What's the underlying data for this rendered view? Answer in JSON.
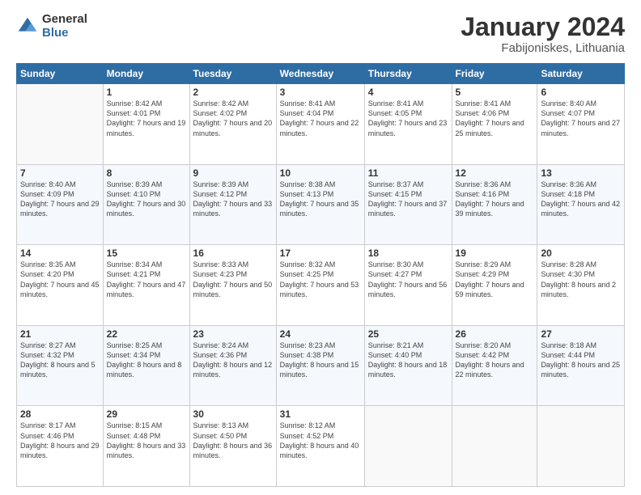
{
  "logo": {
    "general": "General",
    "blue": "Blue"
  },
  "title": "January 2024",
  "subtitle": "Fabijoniskes, Lithuania",
  "days": [
    "Sunday",
    "Monday",
    "Tuesday",
    "Wednesday",
    "Thursday",
    "Friday",
    "Saturday"
  ],
  "weeks": [
    [
      {
        "date": "",
        "sunrise": "",
        "sunset": "",
        "daylight": ""
      },
      {
        "date": "1",
        "sunrise": "Sunrise: 8:42 AM",
        "sunset": "Sunset: 4:01 PM",
        "daylight": "Daylight: 7 hours and 19 minutes."
      },
      {
        "date": "2",
        "sunrise": "Sunrise: 8:42 AM",
        "sunset": "Sunset: 4:02 PM",
        "daylight": "Daylight: 7 hours and 20 minutes."
      },
      {
        "date": "3",
        "sunrise": "Sunrise: 8:41 AM",
        "sunset": "Sunset: 4:04 PM",
        "daylight": "Daylight: 7 hours and 22 minutes."
      },
      {
        "date": "4",
        "sunrise": "Sunrise: 8:41 AM",
        "sunset": "Sunset: 4:05 PM",
        "daylight": "Daylight: 7 hours and 23 minutes."
      },
      {
        "date": "5",
        "sunrise": "Sunrise: 8:41 AM",
        "sunset": "Sunset: 4:06 PM",
        "daylight": "Daylight: 7 hours and 25 minutes."
      },
      {
        "date": "6",
        "sunrise": "Sunrise: 8:40 AM",
        "sunset": "Sunset: 4:07 PM",
        "daylight": "Daylight: 7 hours and 27 minutes."
      }
    ],
    [
      {
        "date": "7",
        "sunrise": "Sunrise: 8:40 AM",
        "sunset": "Sunset: 4:09 PM",
        "daylight": "Daylight: 7 hours and 29 minutes."
      },
      {
        "date": "8",
        "sunrise": "Sunrise: 8:39 AM",
        "sunset": "Sunset: 4:10 PM",
        "daylight": "Daylight: 7 hours and 30 minutes."
      },
      {
        "date": "9",
        "sunrise": "Sunrise: 8:39 AM",
        "sunset": "Sunset: 4:12 PM",
        "daylight": "Daylight: 7 hours and 33 minutes."
      },
      {
        "date": "10",
        "sunrise": "Sunrise: 8:38 AM",
        "sunset": "Sunset: 4:13 PM",
        "daylight": "Daylight: 7 hours and 35 minutes."
      },
      {
        "date": "11",
        "sunrise": "Sunrise: 8:37 AM",
        "sunset": "Sunset: 4:15 PM",
        "daylight": "Daylight: 7 hours and 37 minutes."
      },
      {
        "date": "12",
        "sunrise": "Sunrise: 8:36 AM",
        "sunset": "Sunset: 4:16 PM",
        "daylight": "Daylight: 7 hours and 39 minutes."
      },
      {
        "date": "13",
        "sunrise": "Sunrise: 8:36 AM",
        "sunset": "Sunset: 4:18 PM",
        "daylight": "Daylight: 7 hours and 42 minutes."
      }
    ],
    [
      {
        "date": "14",
        "sunrise": "Sunrise: 8:35 AM",
        "sunset": "Sunset: 4:20 PM",
        "daylight": "Daylight: 7 hours and 45 minutes."
      },
      {
        "date": "15",
        "sunrise": "Sunrise: 8:34 AM",
        "sunset": "Sunset: 4:21 PM",
        "daylight": "Daylight: 7 hours and 47 minutes."
      },
      {
        "date": "16",
        "sunrise": "Sunrise: 8:33 AM",
        "sunset": "Sunset: 4:23 PM",
        "daylight": "Daylight: 7 hours and 50 minutes."
      },
      {
        "date": "17",
        "sunrise": "Sunrise: 8:32 AM",
        "sunset": "Sunset: 4:25 PM",
        "daylight": "Daylight: 7 hours and 53 minutes."
      },
      {
        "date": "18",
        "sunrise": "Sunrise: 8:30 AM",
        "sunset": "Sunset: 4:27 PM",
        "daylight": "Daylight: 7 hours and 56 minutes."
      },
      {
        "date": "19",
        "sunrise": "Sunrise: 8:29 AM",
        "sunset": "Sunset: 4:29 PM",
        "daylight": "Daylight: 7 hours and 59 minutes."
      },
      {
        "date": "20",
        "sunrise": "Sunrise: 8:28 AM",
        "sunset": "Sunset: 4:30 PM",
        "daylight": "Daylight: 8 hours and 2 minutes."
      }
    ],
    [
      {
        "date": "21",
        "sunrise": "Sunrise: 8:27 AM",
        "sunset": "Sunset: 4:32 PM",
        "daylight": "Daylight: 8 hours and 5 minutes."
      },
      {
        "date": "22",
        "sunrise": "Sunrise: 8:25 AM",
        "sunset": "Sunset: 4:34 PM",
        "daylight": "Daylight: 8 hours and 8 minutes."
      },
      {
        "date": "23",
        "sunrise": "Sunrise: 8:24 AM",
        "sunset": "Sunset: 4:36 PM",
        "daylight": "Daylight: 8 hours and 12 minutes."
      },
      {
        "date": "24",
        "sunrise": "Sunrise: 8:23 AM",
        "sunset": "Sunset: 4:38 PM",
        "daylight": "Daylight: 8 hours and 15 minutes."
      },
      {
        "date": "25",
        "sunrise": "Sunrise: 8:21 AM",
        "sunset": "Sunset: 4:40 PM",
        "daylight": "Daylight: 8 hours and 18 minutes."
      },
      {
        "date": "26",
        "sunrise": "Sunrise: 8:20 AM",
        "sunset": "Sunset: 4:42 PM",
        "daylight": "Daylight: 8 hours and 22 minutes."
      },
      {
        "date": "27",
        "sunrise": "Sunrise: 8:18 AM",
        "sunset": "Sunset: 4:44 PM",
        "daylight": "Daylight: 8 hours and 25 minutes."
      }
    ],
    [
      {
        "date": "28",
        "sunrise": "Sunrise: 8:17 AM",
        "sunset": "Sunset: 4:46 PM",
        "daylight": "Daylight: 8 hours and 29 minutes."
      },
      {
        "date": "29",
        "sunrise": "Sunrise: 8:15 AM",
        "sunset": "Sunset: 4:48 PM",
        "daylight": "Daylight: 8 hours and 33 minutes."
      },
      {
        "date": "30",
        "sunrise": "Sunrise: 8:13 AM",
        "sunset": "Sunset: 4:50 PM",
        "daylight": "Daylight: 8 hours and 36 minutes."
      },
      {
        "date": "31",
        "sunrise": "Sunrise: 8:12 AM",
        "sunset": "Sunset: 4:52 PM",
        "daylight": "Daylight: 8 hours and 40 minutes."
      },
      {
        "date": "",
        "sunrise": "",
        "sunset": "",
        "daylight": ""
      },
      {
        "date": "",
        "sunrise": "",
        "sunset": "",
        "daylight": ""
      },
      {
        "date": "",
        "sunrise": "",
        "sunset": "",
        "daylight": ""
      }
    ]
  ]
}
